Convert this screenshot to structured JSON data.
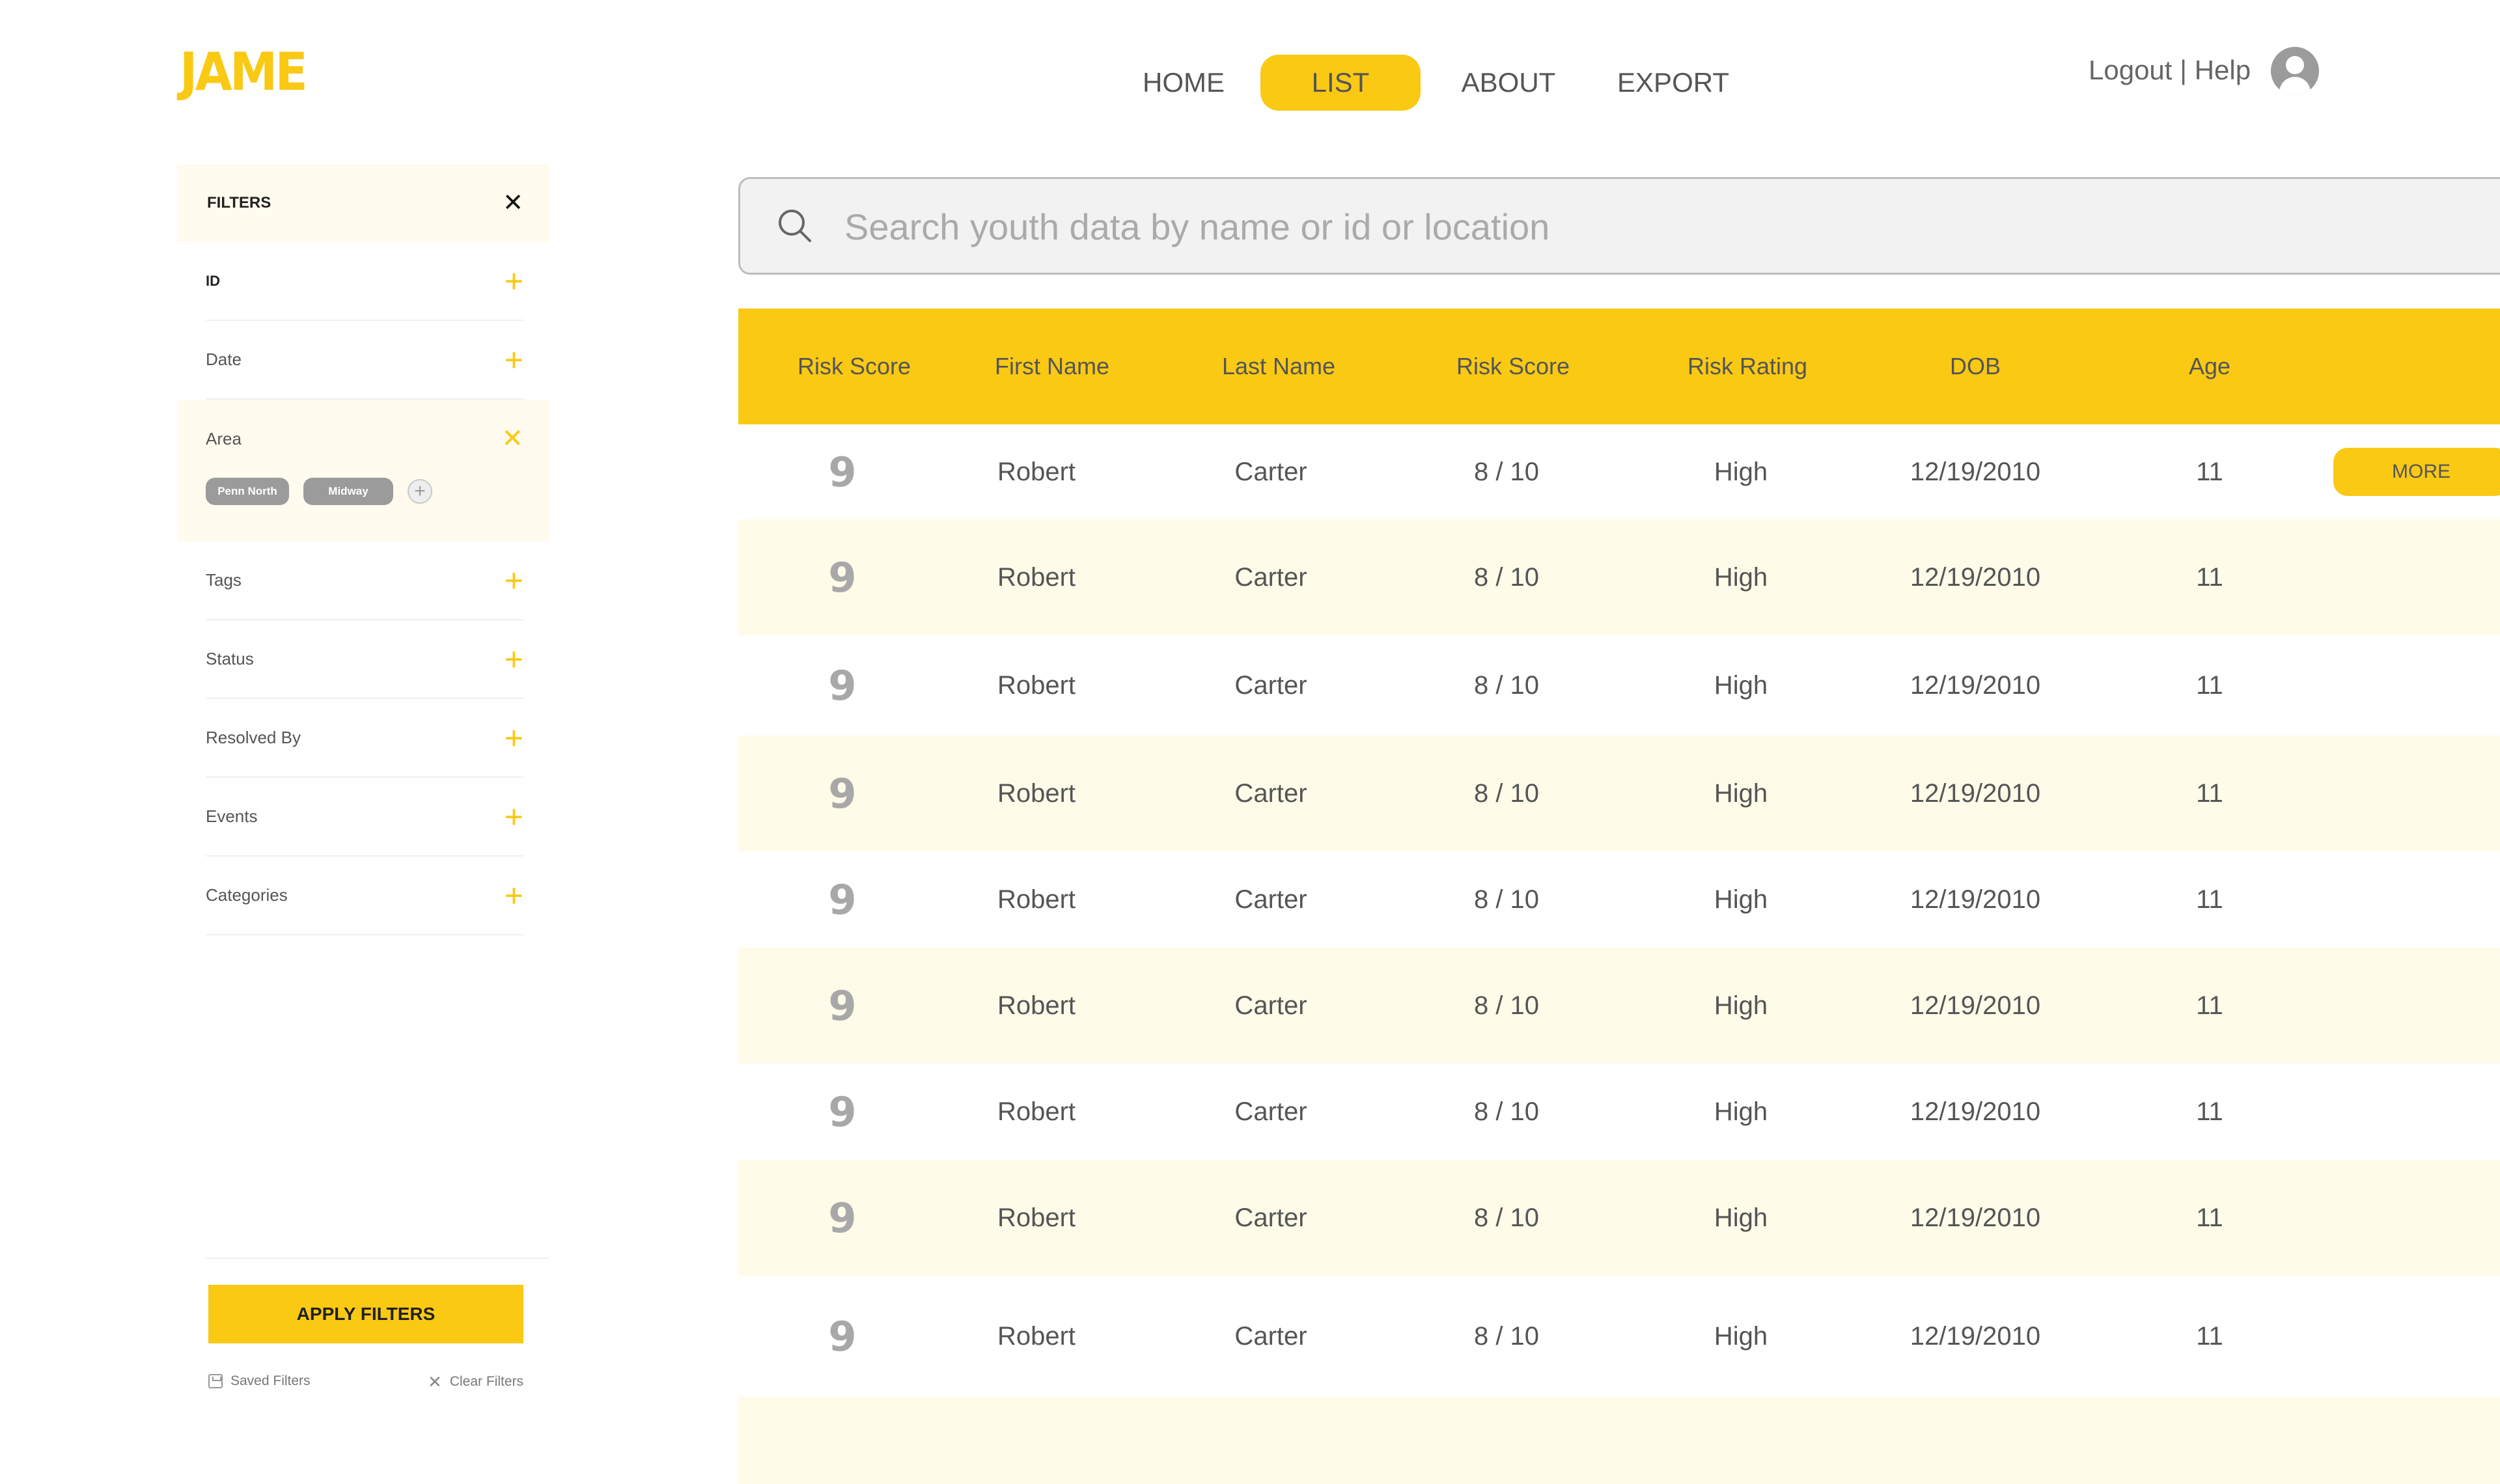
{
  "app": {
    "logo": "JAME"
  },
  "nav": {
    "items": [
      {
        "label": "HOME",
        "active": false
      },
      {
        "label": "LIST",
        "active": true
      },
      {
        "label": "ABOUT",
        "active": false
      },
      {
        "label": "EXPORT",
        "active": false
      }
    ],
    "logout": "Logout",
    "separator": " | ",
    "help": "Help",
    "avatar_icon": "user-circle-icon"
  },
  "sidebar": {
    "title": "FILTERS",
    "close_icon": "close-icon",
    "filters": [
      {
        "label": "ID"
      },
      {
        "label": "Date"
      },
      {
        "label": "Area",
        "expanded": true,
        "chips": [
          "Penn North",
          "Midway"
        ]
      },
      {
        "label": "Tags"
      },
      {
        "label": "Status"
      },
      {
        "label": "Resolved By"
      },
      {
        "label": "Events"
      },
      {
        "label": "Categories"
      }
    ],
    "apply_label": "APPLY FILTERS",
    "saved_label": "Saved Filters",
    "clear_label": "Clear Filters"
  },
  "search": {
    "placeholder": "Search youth data by name or id or location",
    "value": ""
  },
  "table": {
    "headers": [
      "Risk Score",
      "First Name",
      "Last Name",
      "Risk Score",
      "Risk Rating",
      "DOB",
      "Age"
    ],
    "more_label": "MORE",
    "rows": [
      [
        "9",
        "Robert",
        "Carter",
        "8 / 10",
        "High",
        "12/19/2010",
        "11"
      ],
      [
        "9",
        "Robert",
        "Carter",
        "8 / 10",
        "High",
        "12/19/2010",
        "11"
      ],
      [
        "9",
        "Robert",
        "Carter",
        "8 / 10",
        "High",
        "12/19/2010",
        "11"
      ],
      [
        "9",
        "Robert",
        "Carter",
        "8 / 10",
        "High",
        "12/19/2010",
        "11"
      ],
      [
        "9",
        "Robert",
        "Carter",
        "8 / 10",
        "High",
        "12/19/2010",
        "11"
      ],
      [
        "9",
        "Robert",
        "Carter",
        "8 / 10",
        "High",
        "12/19/2010",
        "11"
      ],
      [
        "9",
        "Robert",
        "Carter",
        "8 / 10",
        "High",
        "12/19/2010",
        "11"
      ],
      [
        "9",
        "Robert",
        "Carter",
        "8 / 10",
        "High",
        "12/19/2010",
        "11"
      ],
      [
        "9",
        "Robert",
        "Carter",
        "8 / 10",
        "High",
        "12/19/2010",
        "11"
      ]
    ]
  },
  "colors": {
    "accent": "#f9c914",
    "row_alt": "#fefbe9",
    "text": "#555555",
    "muted": "#a8a8a8"
  }
}
